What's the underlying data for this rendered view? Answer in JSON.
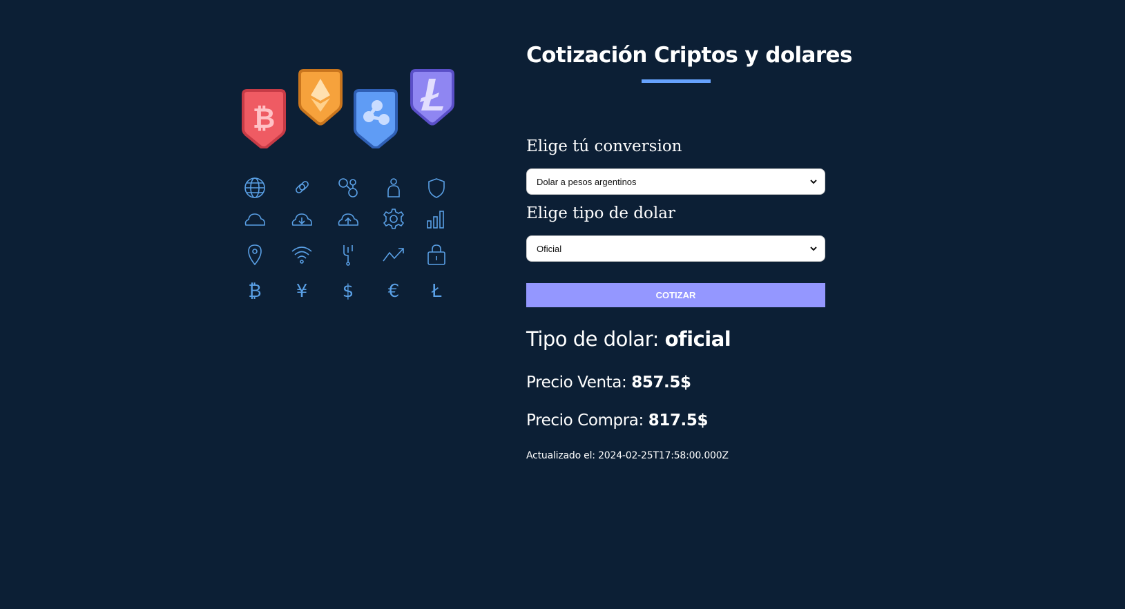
{
  "header": {
    "title": "Cotización Criptos y dolares"
  },
  "form": {
    "conversion_label": "Elige tú conversion",
    "conversion_value": "Dolar a pesos argentinos",
    "dolar_label": "Elige tipo de dolar",
    "dolar_value": "Oficial",
    "submit_label": "COTIZAR"
  },
  "result": {
    "type_label": "Tipo de dolar:",
    "type_value": "oficial",
    "venta_label": "Precio Venta:",
    "venta_value": "857.5$",
    "compra_label": "Precio Compra:",
    "compra_value": "817.5$",
    "updated_label": "Actualizado el:",
    "updated_value": "2024-02-25T17:58:00.000Z"
  },
  "illustration": {
    "badges": [
      "bitcoin-badge",
      "ethereum-badge",
      "ripple-badge",
      "litecoin-badge"
    ],
    "icons": [
      "globe-icon",
      "link-icon",
      "nodes-icon",
      "person-icon",
      "shield-icon",
      "cloud-icon",
      "cloud-download-icon",
      "cloud-upload-icon",
      "gear-icon",
      "bar-chart-icon",
      "location-pin-icon",
      "wifi-icon",
      "fork-icon",
      "trend-up-icon",
      "padlock-icon",
      "bitcoin-icon",
      "yen-icon",
      "dollar-icon",
      "euro-icon",
      "litecoin-icon"
    ]
  },
  "colors": {
    "background": "#0c1f35",
    "accent": "#66a2fe",
    "button": "#9497ff",
    "icon_stroke": "#5aa0e6",
    "badge_bitcoin": "#ef5b63",
    "badge_ethereum": "#f6a23c",
    "badge_ripple": "#5f9cf5",
    "badge_litecoin": "#8f86f2"
  }
}
